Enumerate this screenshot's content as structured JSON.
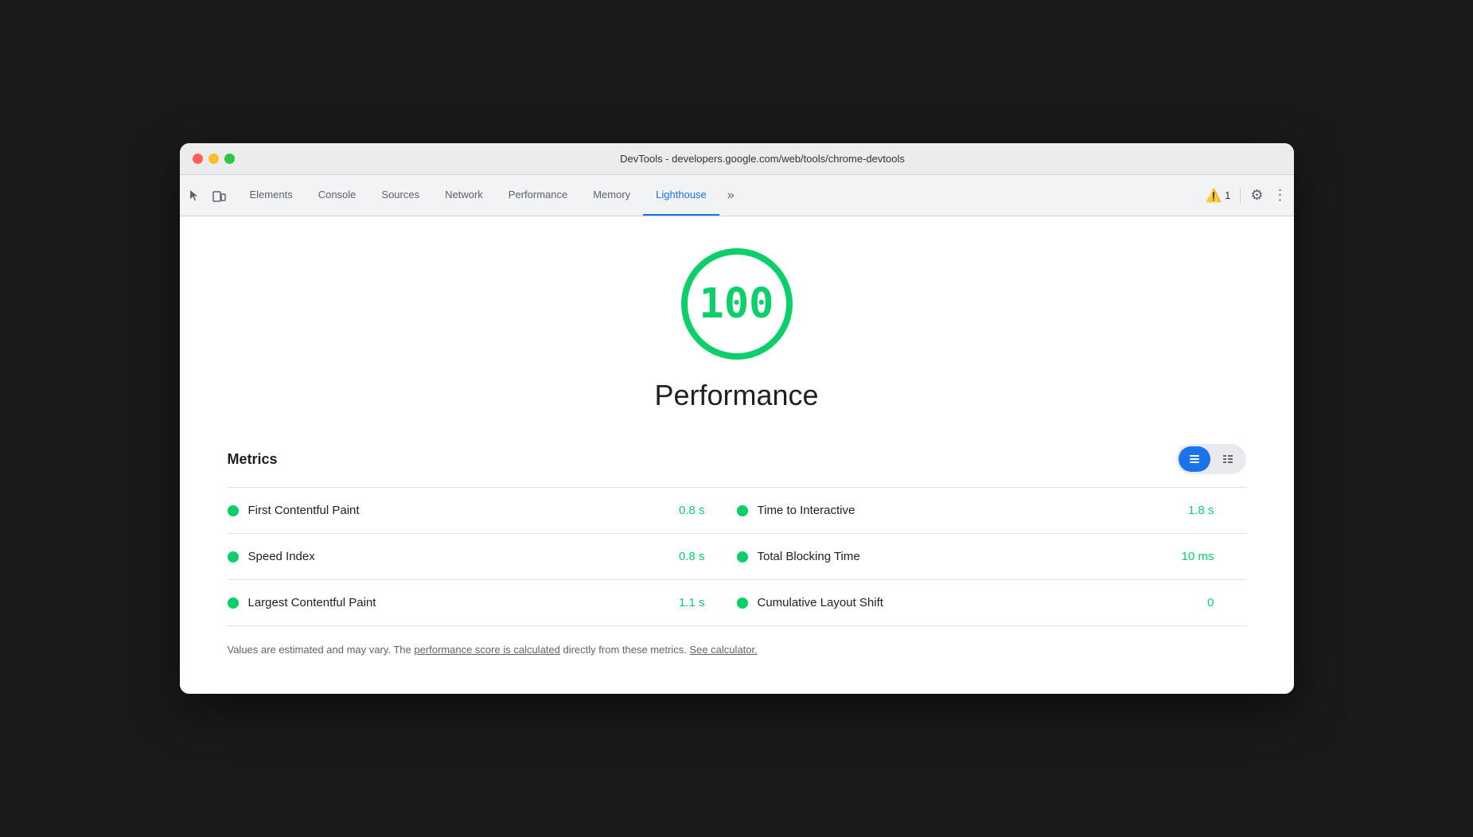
{
  "window": {
    "title": "DevTools - developers.google.com/web/tools/chrome-devtools"
  },
  "tabs": [
    {
      "id": "elements",
      "label": "Elements",
      "active": false
    },
    {
      "id": "console",
      "label": "Console",
      "active": false
    },
    {
      "id": "sources",
      "label": "Sources",
      "active": false
    },
    {
      "id": "network",
      "label": "Network",
      "active": false
    },
    {
      "id": "performance",
      "label": "Performance",
      "active": false
    },
    {
      "id": "memory",
      "label": "Memory",
      "active": false
    },
    {
      "id": "lighthouse",
      "label": "Lighthouse",
      "active": true
    }
  ],
  "tab_overflow_label": "»",
  "warning": {
    "count": "1"
  },
  "lighthouse": {
    "score": "100",
    "category": "Performance",
    "metrics_title": "Metrics",
    "metrics": [
      {
        "left_name": "First Contentful Paint",
        "left_value": "0.8 s",
        "right_name": "Time to Interactive",
        "right_value": "1.8 s"
      },
      {
        "left_name": "Speed Index",
        "left_value": "0.8 s",
        "right_name": "Total Blocking Time",
        "right_value": "10 ms"
      },
      {
        "left_name": "Largest Contentful Paint",
        "left_value": "1.1 s",
        "right_name": "Cumulative Layout Shift",
        "right_value": "0"
      }
    ],
    "footer": {
      "text_before": "Values are estimated and may vary. The ",
      "link1_text": "performance score is calculated",
      "text_middle": " directly from these metrics. ",
      "link2_text": "See calculator.",
      "text_after": ""
    }
  },
  "icons": {
    "cursor": "⬡",
    "device": "⬜",
    "warning": "⚠",
    "gear": "⚙",
    "more": "⋮",
    "table_view": "≡",
    "list_view": "☰"
  },
  "colors": {
    "green": "#0cce6b",
    "blue_active": "#1a73e8",
    "tab_active_border": "#1a73e8"
  }
}
